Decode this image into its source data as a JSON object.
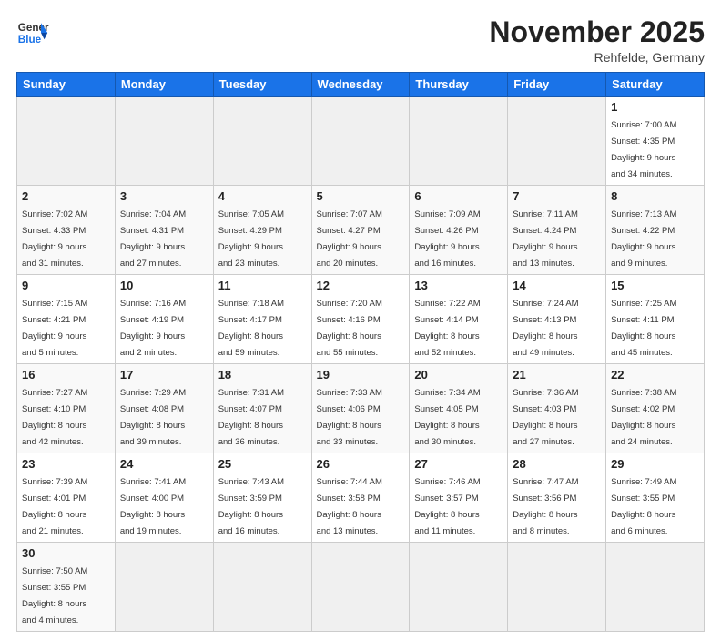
{
  "header": {
    "logo_general": "General",
    "logo_blue": "Blue",
    "month_title": "November 2025",
    "location": "Rehfelde, Germany"
  },
  "weekdays": [
    "Sunday",
    "Monday",
    "Tuesday",
    "Wednesday",
    "Thursday",
    "Friday",
    "Saturday"
  ],
  "weeks": [
    [
      {
        "day": "",
        "info": ""
      },
      {
        "day": "",
        "info": ""
      },
      {
        "day": "",
        "info": ""
      },
      {
        "day": "",
        "info": ""
      },
      {
        "day": "",
        "info": ""
      },
      {
        "day": "",
        "info": ""
      },
      {
        "day": "1",
        "info": "Sunrise: 7:00 AM\nSunset: 4:35 PM\nDaylight: 9 hours\nand 34 minutes."
      }
    ],
    [
      {
        "day": "2",
        "info": "Sunrise: 7:02 AM\nSunset: 4:33 PM\nDaylight: 9 hours\nand 31 minutes."
      },
      {
        "day": "3",
        "info": "Sunrise: 7:04 AM\nSunset: 4:31 PM\nDaylight: 9 hours\nand 27 minutes."
      },
      {
        "day": "4",
        "info": "Sunrise: 7:05 AM\nSunset: 4:29 PM\nDaylight: 9 hours\nand 23 minutes."
      },
      {
        "day": "5",
        "info": "Sunrise: 7:07 AM\nSunset: 4:27 PM\nDaylight: 9 hours\nand 20 minutes."
      },
      {
        "day": "6",
        "info": "Sunrise: 7:09 AM\nSunset: 4:26 PM\nDaylight: 9 hours\nand 16 minutes."
      },
      {
        "day": "7",
        "info": "Sunrise: 7:11 AM\nSunset: 4:24 PM\nDaylight: 9 hours\nand 13 minutes."
      },
      {
        "day": "8",
        "info": "Sunrise: 7:13 AM\nSunset: 4:22 PM\nDaylight: 9 hours\nand 9 minutes."
      }
    ],
    [
      {
        "day": "9",
        "info": "Sunrise: 7:15 AM\nSunset: 4:21 PM\nDaylight: 9 hours\nand 5 minutes."
      },
      {
        "day": "10",
        "info": "Sunrise: 7:16 AM\nSunset: 4:19 PM\nDaylight: 9 hours\nand 2 minutes."
      },
      {
        "day": "11",
        "info": "Sunrise: 7:18 AM\nSunset: 4:17 PM\nDaylight: 8 hours\nand 59 minutes."
      },
      {
        "day": "12",
        "info": "Sunrise: 7:20 AM\nSunset: 4:16 PM\nDaylight: 8 hours\nand 55 minutes."
      },
      {
        "day": "13",
        "info": "Sunrise: 7:22 AM\nSunset: 4:14 PM\nDaylight: 8 hours\nand 52 minutes."
      },
      {
        "day": "14",
        "info": "Sunrise: 7:24 AM\nSunset: 4:13 PM\nDaylight: 8 hours\nand 49 minutes."
      },
      {
        "day": "15",
        "info": "Sunrise: 7:25 AM\nSunset: 4:11 PM\nDaylight: 8 hours\nand 45 minutes."
      }
    ],
    [
      {
        "day": "16",
        "info": "Sunrise: 7:27 AM\nSunset: 4:10 PM\nDaylight: 8 hours\nand 42 minutes."
      },
      {
        "day": "17",
        "info": "Sunrise: 7:29 AM\nSunset: 4:08 PM\nDaylight: 8 hours\nand 39 minutes."
      },
      {
        "day": "18",
        "info": "Sunrise: 7:31 AM\nSunset: 4:07 PM\nDaylight: 8 hours\nand 36 minutes."
      },
      {
        "day": "19",
        "info": "Sunrise: 7:33 AM\nSunset: 4:06 PM\nDaylight: 8 hours\nand 33 minutes."
      },
      {
        "day": "20",
        "info": "Sunrise: 7:34 AM\nSunset: 4:05 PM\nDaylight: 8 hours\nand 30 minutes."
      },
      {
        "day": "21",
        "info": "Sunrise: 7:36 AM\nSunset: 4:03 PM\nDaylight: 8 hours\nand 27 minutes."
      },
      {
        "day": "22",
        "info": "Sunrise: 7:38 AM\nSunset: 4:02 PM\nDaylight: 8 hours\nand 24 minutes."
      }
    ],
    [
      {
        "day": "23",
        "info": "Sunrise: 7:39 AM\nSunset: 4:01 PM\nDaylight: 8 hours\nand 21 minutes."
      },
      {
        "day": "24",
        "info": "Sunrise: 7:41 AM\nSunset: 4:00 PM\nDaylight: 8 hours\nand 19 minutes."
      },
      {
        "day": "25",
        "info": "Sunrise: 7:43 AM\nSunset: 3:59 PM\nDaylight: 8 hours\nand 16 minutes."
      },
      {
        "day": "26",
        "info": "Sunrise: 7:44 AM\nSunset: 3:58 PM\nDaylight: 8 hours\nand 13 minutes."
      },
      {
        "day": "27",
        "info": "Sunrise: 7:46 AM\nSunset: 3:57 PM\nDaylight: 8 hours\nand 11 minutes."
      },
      {
        "day": "28",
        "info": "Sunrise: 7:47 AM\nSunset: 3:56 PM\nDaylight: 8 hours\nand 8 minutes."
      },
      {
        "day": "29",
        "info": "Sunrise: 7:49 AM\nSunset: 3:55 PM\nDaylight: 8 hours\nand 6 minutes."
      }
    ],
    [
      {
        "day": "30",
        "info": "Sunrise: 7:50 AM\nSunset: 3:55 PM\nDaylight: 8 hours\nand 4 minutes."
      },
      {
        "day": "",
        "info": ""
      },
      {
        "day": "",
        "info": ""
      },
      {
        "day": "",
        "info": ""
      },
      {
        "day": "",
        "info": ""
      },
      {
        "day": "",
        "info": ""
      },
      {
        "day": "",
        "info": ""
      }
    ]
  ]
}
